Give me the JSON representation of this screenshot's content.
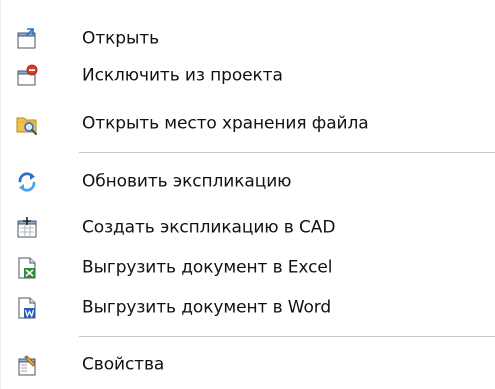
{
  "menu": {
    "items": [
      {
        "label": "Открыть",
        "icon": "open-icon"
      },
      {
        "label": "Исключить из проекта",
        "icon": "exclude-icon"
      },
      {
        "label": "Открыть место хранения файла",
        "icon": "folder-search-icon"
      },
      {
        "label": "Обновить экспликацию",
        "icon": "refresh-icon"
      },
      {
        "label": "Создать экспликацию в CAD",
        "icon": "create-cad-icon"
      },
      {
        "label": "Выгрузить документ в Excel",
        "icon": "excel-export-icon"
      },
      {
        "label": "Выгрузить документ в Word",
        "icon": "word-export-icon"
      },
      {
        "label": "Свойства",
        "icon": "properties-icon"
      }
    ]
  },
  "colors": {
    "excel_green": "#2e8b3a",
    "word_blue": "#2b5cb8",
    "exclude_red": "#d93a2b",
    "refresh_blue": "#2a6fc9",
    "folder_yellow": "#f2c14e"
  }
}
